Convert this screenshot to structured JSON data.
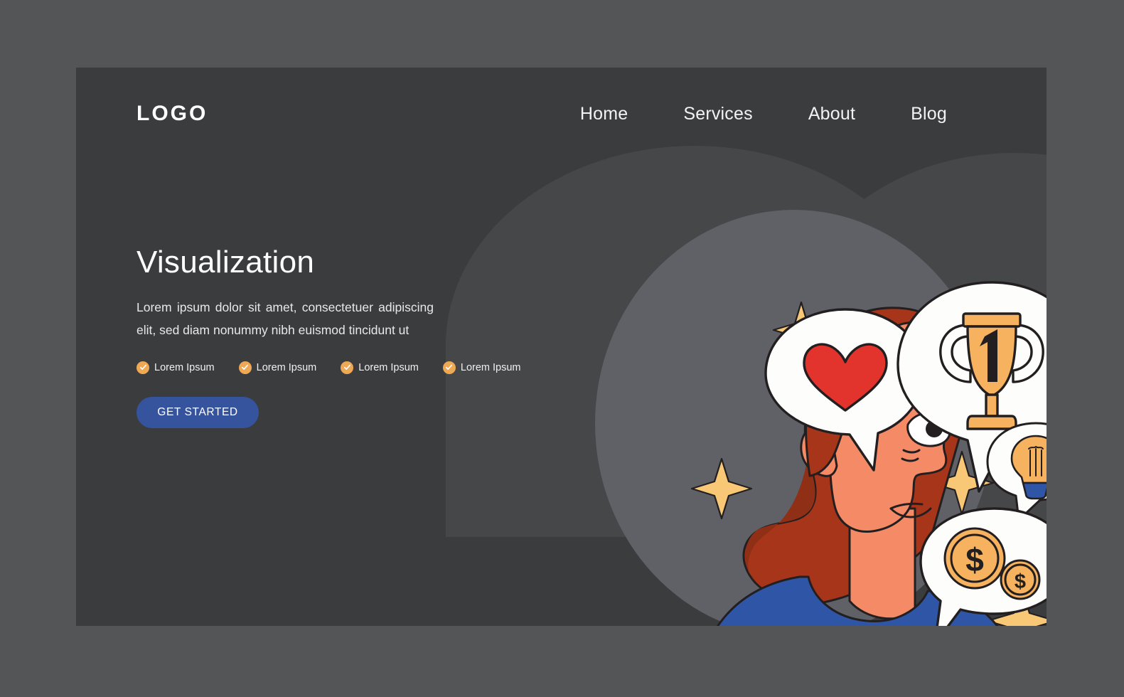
{
  "page": {
    "outer_background": "#545557",
    "card_background": "#3b3c3e",
    "blob_color": "#464749",
    "ellipse_color": "#5f6167"
  },
  "header": {
    "logo": "LOGO",
    "nav": [
      {
        "label": "Home"
      },
      {
        "label": "Services"
      },
      {
        "label": "About"
      },
      {
        "label": "Blog"
      }
    ]
  },
  "hero": {
    "title": "Visualization",
    "body": "Lorem ipsum dolor sit amet, consectetuer adipiscing elit, sed diam nonummy nibh euismod tincidunt ut",
    "features": [
      {
        "label": "Lorem Ipsum",
        "icon": "check-circle-icon"
      },
      {
        "label": "Lorem Ipsum",
        "icon": "check-circle-icon"
      },
      {
        "label": "Lorem Ipsum",
        "icon": "check-circle-icon"
      },
      {
        "label": "Lorem Ipsum",
        "icon": "check-circle-icon"
      }
    ],
    "cta_label": "GET STARTED",
    "cta_color": "#36539e",
    "check_color": "#efa854"
  },
  "illustration": {
    "description": "Woman in profile with thought bubbles",
    "bubbles": [
      {
        "name": "heart-bubble",
        "icon": "heart-icon",
        "color": "#e2342c"
      },
      {
        "name": "trophy-bubble",
        "icon": "trophy-icon",
        "label": "1",
        "color": "#f6b25e"
      },
      {
        "name": "lightbulb-bubble",
        "icon": "lightbulb-icon",
        "color": "#f6b25e"
      },
      {
        "name": "money-bubble",
        "icon": "coins-icon",
        "symbol": "$",
        "color": "#f6b25e"
      }
    ],
    "sparkle_count": 5,
    "colors": {
      "skin": "#f58b66",
      "hair": "#a73519",
      "hair_dark": "#8f2f16",
      "shirt": "#2f55a7",
      "bubble_fill": "#fdfdfb",
      "outline": "#231f20",
      "sparkle": "#f8c877",
      "gold": "#f6b25e",
      "heart": "#e2342c"
    }
  }
}
